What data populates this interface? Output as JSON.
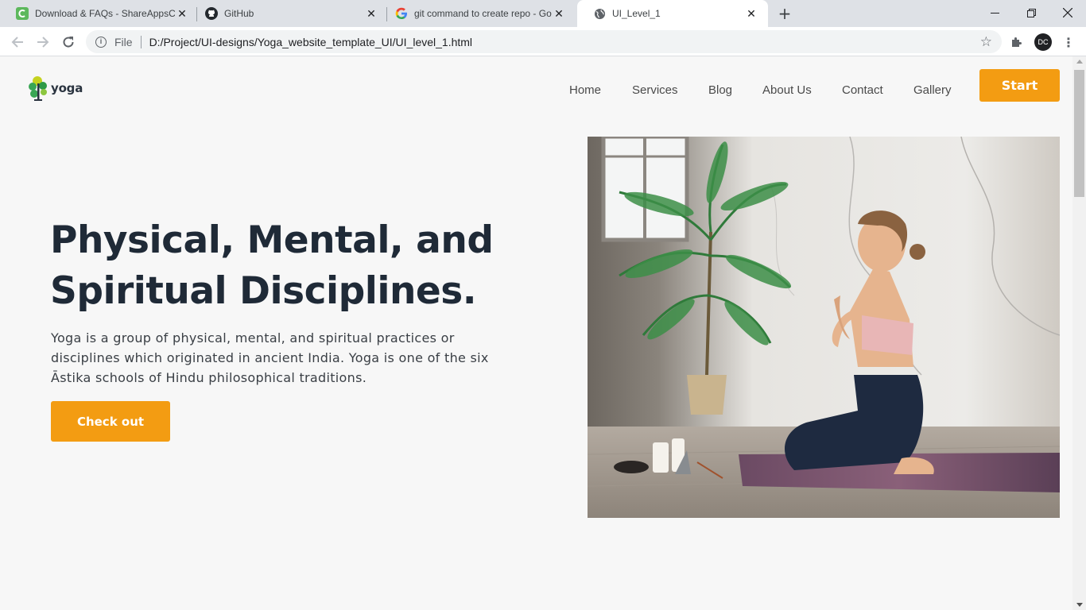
{
  "browser": {
    "tabs": [
      {
        "title": "Download & FAQs - ShareAppsC",
        "icon": "shareapps-icon",
        "active": false
      },
      {
        "title": "GitHub",
        "icon": "github-icon",
        "active": false
      },
      {
        "title": "git command to create repo - Go",
        "icon": "google-icon",
        "active": false
      },
      {
        "title": "UI_Level_1",
        "icon": "globe-icon",
        "active": true
      }
    ],
    "address": {
      "scheme_label": "File",
      "url": "D:/Project/UI-designs/Yoga_website_template_UI/UI_level_1.html"
    },
    "profile_initials": "DC"
  },
  "page": {
    "logo_text": "yoga",
    "nav": [
      "Home",
      "Services",
      "Blog",
      "About Us",
      "Contact",
      "Gallery"
    ],
    "start_label": "Start",
    "hero": {
      "title": "Physical, Mental, and Spiritual Disciplines.",
      "description": "Yoga is a group of physical, mental, and spiritual practices or disciplines which originated in ancient India. Yoga is one of the six Āstika schools of Hindu philosophical traditions.",
      "cta_label": "Check out"
    }
  },
  "colors": {
    "accent": "#f39c12",
    "heading": "#1f2a37",
    "background": "#f7f7f7"
  }
}
